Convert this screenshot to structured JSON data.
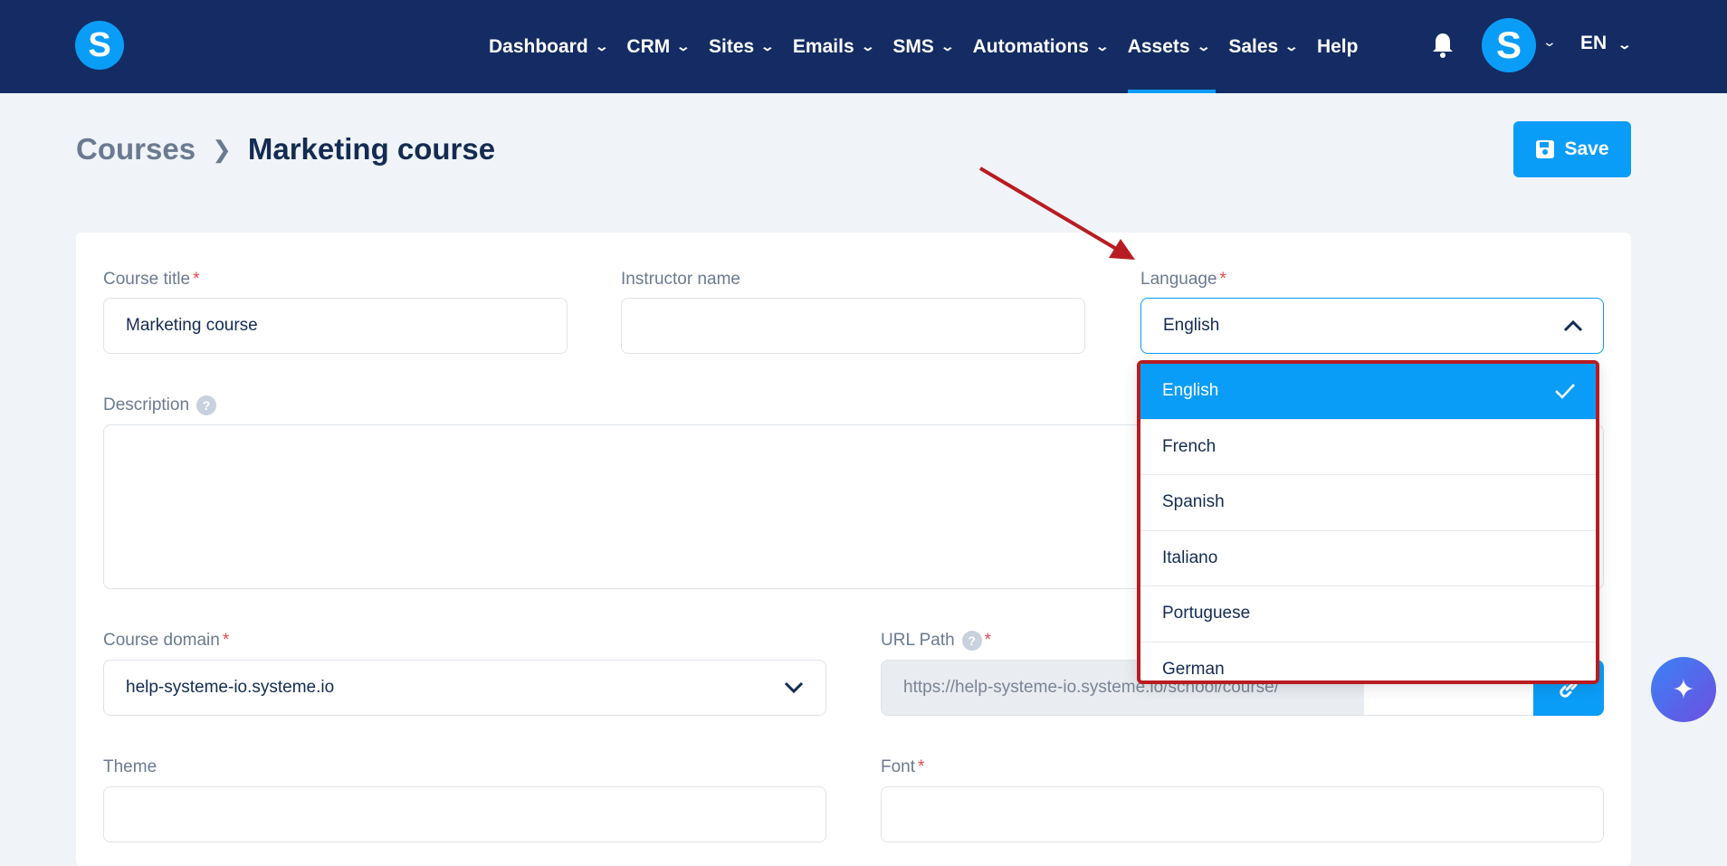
{
  "nav": {
    "logo": "S",
    "items": [
      {
        "label": "Dashboard",
        "chevron": true
      },
      {
        "label": "CRM",
        "chevron": true
      },
      {
        "label": "Sites",
        "chevron": true
      },
      {
        "label": "Emails",
        "chevron": true
      },
      {
        "label": "SMS",
        "chevron": true
      },
      {
        "label": "Automations",
        "chevron": true
      },
      {
        "label": "Assets",
        "chevron": true,
        "active": true
      },
      {
        "label": "Sales",
        "chevron": true
      },
      {
        "label": "Help",
        "chevron": false
      }
    ],
    "avatar": "S",
    "language": "EN"
  },
  "breadcrumb": {
    "parent": "Courses",
    "current": "Marketing course"
  },
  "save_label": "Save",
  "form": {
    "course_title": {
      "label": "Course title",
      "value": "Marketing course"
    },
    "instructor": {
      "label": "Instructor name",
      "value": ""
    },
    "language": {
      "label": "Language",
      "value": "English",
      "options": [
        "English",
        "French",
        "Spanish",
        "Italiano",
        "Portuguese",
        "German"
      ]
    },
    "description": {
      "label": "Description",
      "help": "?"
    },
    "domain": {
      "label": "Course domain",
      "value": "help-systeme-io.systeme.io"
    },
    "url_path": {
      "label": "URL Path",
      "help": "?",
      "prefix": "https://help-systeme-io.systeme.io/school/course/",
      "value": ""
    },
    "theme": {
      "label": "Theme"
    },
    "font": {
      "label": "Font"
    }
  },
  "colors": {
    "nav": "#142c63",
    "primary": "#0a9df7",
    "highlight": "#b81c22"
  }
}
